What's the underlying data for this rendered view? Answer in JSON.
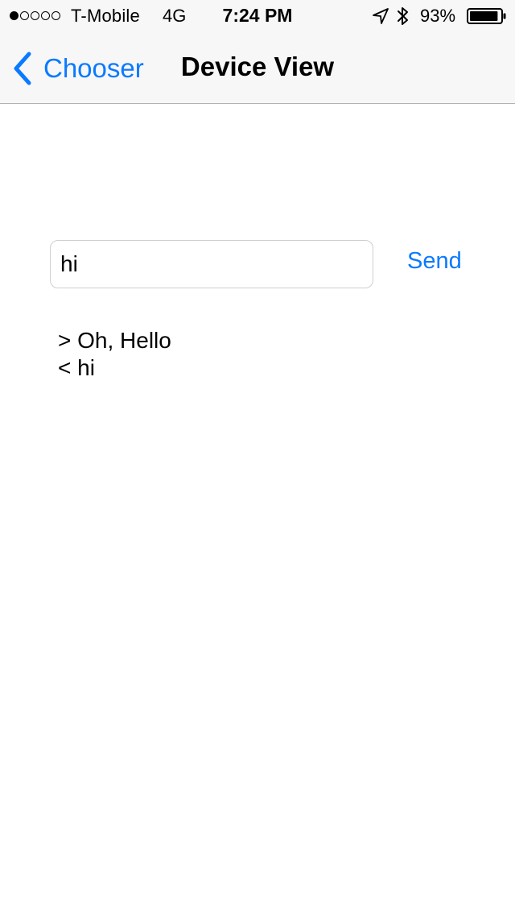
{
  "status_bar": {
    "carrier": "T-Mobile",
    "network": "4G",
    "time": "7:24 PM",
    "battery_percent": "93%",
    "battery_level": 0.93,
    "signal_bars_filled": 1,
    "signal_bars_total": 5,
    "icons": [
      "location-arrow-icon",
      "bluetooth-icon",
      "battery-icon"
    ]
  },
  "nav": {
    "back_label": "Chooser",
    "title": "Device View",
    "back_icon": "chevron-left-icon"
  },
  "composer": {
    "input_value": "hi",
    "send_label": "Send"
  },
  "log": [
    "> Oh, Hello",
    "< hi"
  ],
  "colors": {
    "accent": "#0a7aff",
    "bar_background": "#f7f7f7"
  }
}
